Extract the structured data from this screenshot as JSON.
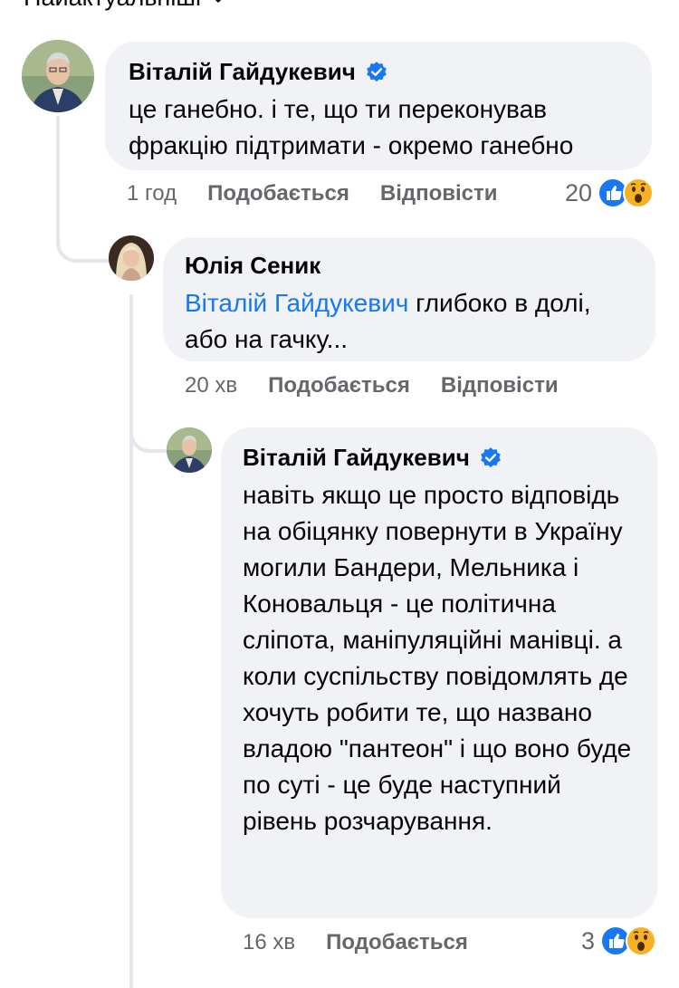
{
  "header": {
    "sort_label": "Найактуальніші"
  },
  "comments": [
    {
      "author": "Віталій Гайдукевич",
      "text": "це ганебно. і те, що ти переконував фракцію підтримати - окремо ганебно",
      "time": "1 год",
      "like_label": "Подобається",
      "reply_label": "Відповісти",
      "reaction_count": "20",
      "reaction_icons": [
        "like-icon",
        "wow-icon"
      ]
    },
    {
      "author": "Юлія Сеник",
      "mention": "Віталій Гайдукевич",
      "text": "глибоко в долі, або на гачку...",
      "time": "20 хв",
      "like_label": "Подобається",
      "reply_label": "Відповісти"
    },
    {
      "author": "Віталій Гайдукевич",
      "text": "навіть якщо це просто відповідь на обіцянку повернути в Україну могили Бандери, Мельника і Коновальця - це політична сліпота, маніпуляційні манівці. а коли суспільству повідомлять де хочуть робити те, що названо владою \"пантеон\" і що воно буде по суті - це буде наступний рівень розчарування.",
      "time": "16 хв",
      "like_label": "Подобається",
      "reaction_count": "3",
      "reaction_icons": [
        "like-icon",
        "wow-icon"
      ]
    }
  ],
  "colors": {
    "link": "#1877f2",
    "bubble": "#f0f2f5",
    "meta": "#65676b",
    "like": "#1877f2",
    "wow": "#f7b125"
  }
}
